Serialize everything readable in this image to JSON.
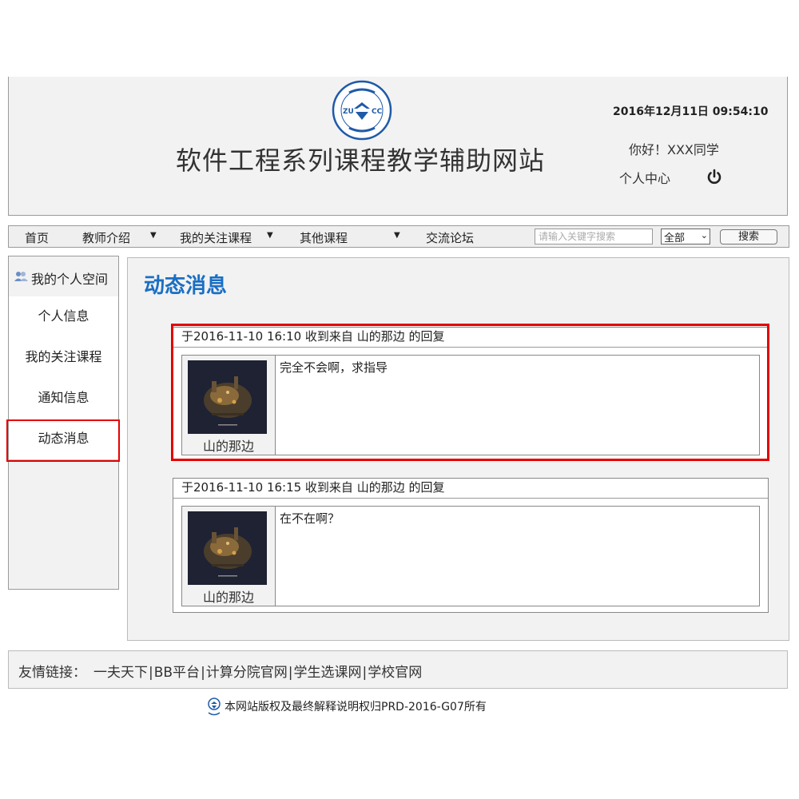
{
  "header": {
    "logo_letters": [
      "ZU",
      "CC"
    ],
    "site_title": "软件工程系列课程教学辅助网站",
    "datetime": "2016年12月11日 09:54:10",
    "greeting": "你好！XXX同学",
    "personal_center": "个人中心",
    "power_icon": "power-icon"
  },
  "nav": {
    "items": [
      {
        "label": "首页"
      },
      {
        "label": "教师介绍",
        "dropdown": true
      },
      {
        "label": "我的关注课程",
        "dropdown": true
      },
      {
        "label": "其他课程",
        "dropdown": true
      },
      {
        "label": "交流论坛"
      }
    ],
    "caret": "▼",
    "search_placeholder": "请输入关键字搜索",
    "scope_value": "全部",
    "search_button": "搜索"
  },
  "sidebar": {
    "title": "我的个人空间",
    "items": [
      {
        "label": "个人信息"
      },
      {
        "label": "我的关注课程"
      },
      {
        "label": "通知信息"
      },
      {
        "label": "动态消息",
        "active": true
      }
    ]
  },
  "main": {
    "title": "动态消息",
    "messages": [
      {
        "header": "于2016-11-10 16:10 收到来自 山的那边 的回复",
        "author": "山的那边",
        "text": "完全不会啊，求指导",
        "highlighted": true
      },
      {
        "header": "于2016-11-10 16:15 收到来自 山的那边 的回复",
        "author": "山的那边",
        "text": "在不在啊？",
        "highlighted": false
      }
    ]
  },
  "footer": {
    "links_label": "友情链接：",
    "links": [
      "一夫天下",
      "BB平台",
      "计算分院官网",
      "学生选课网",
      "学校官网"
    ],
    "separator": "|",
    "copyright": "本网站版权及最终解释说明权归PRD-2016-G07所有"
  },
  "colors": {
    "accent_blue": "#1a6fc4",
    "highlight_red": "#e60000",
    "logo_blue": "#1e5aa8",
    "panel_gray": "#f2f2f2"
  }
}
